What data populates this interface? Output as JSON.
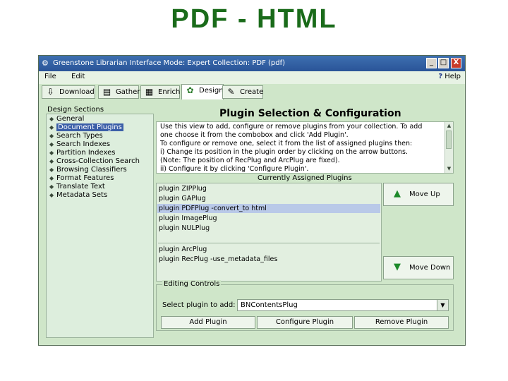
{
  "slide": {
    "title": "PDF - HTML"
  },
  "window": {
    "title": "Greenstone Librarian Interface Mode: Expert Collection: PDF (pdf)",
    "buttons": {
      "minimize": "_",
      "maximize": "□",
      "close": "X"
    }
  },
  "menu": {
    "file": "File",
    "edit": "Edit",
    "help": "Help"
  },
  "tabs": [
    {
      "label": "Download",
      "icon": "download-icon"
    },
    {
      "label": "Gather",
      "icon": "gather-icon"
    },
    {
      "label": "Enrich",
      "icon": "enrich-icon"
    },
    {
      "label": "Design",
      "icon": "design-icon",
      "active": true
    },
    {
      "label": "Create",
      "icon": "create-icon"
    }
  ],
  "sections": {
    "header": "Design Sections",
    "items": [
      "General",
      "Document Plugins",
      "Search Types",
      "Search Indexes",
      "Partition Indexes",
      "Cross-Collection Search",
      "Browsing Classifiers",
      "Format Features",
      "Translate Text",
      "Metadata Sets"
    ],
    "selected_index": 1
  },
  "plugins": {
    "title": "Plugin Selection & Configuration",
    "description": [
      "Use this view to add, configure or remove plugins from your collection. To add",
      "one choose it from the combobox and click 'Add Plugin'.",
      "To configure or remove one, select it from the list of assigned plugins then:",
      "i)   Change its position in the plugin order by clicking on the arrow buttons.",
      "(Note: The position of RecPlug and ArcPlug are fixed).",
      "ii)  Configure it by clicking 'Configure Plugin'."
    ],
    "assigned_label": "Currently Assigned Plugins",
    "assigned": [
      "plugin ZIPPlug",
      "plugin GAPlug",
      "plugin PDFPlug -convert_to html",
      "plugin ImagePlug",
      "plugin NULPlug"
    ],
    "fixed": [
      "plugin ArcPlug",
      "plugin RecPlug -use_metadata_files"
    ],
    "selected_index": 2,
    "move_up": "Move Up",
    "move_down": "Move Down",
    "editing": {
      "legend": "Editing Controls",
      "select_label": "Select plugin to add:",
      "combo_value": "BNContentsPlug",
      "add": "Add Plugin",
      "configure": "Configure Plugin",
      "remove": "Remove Plugin"
    }
  }
}
